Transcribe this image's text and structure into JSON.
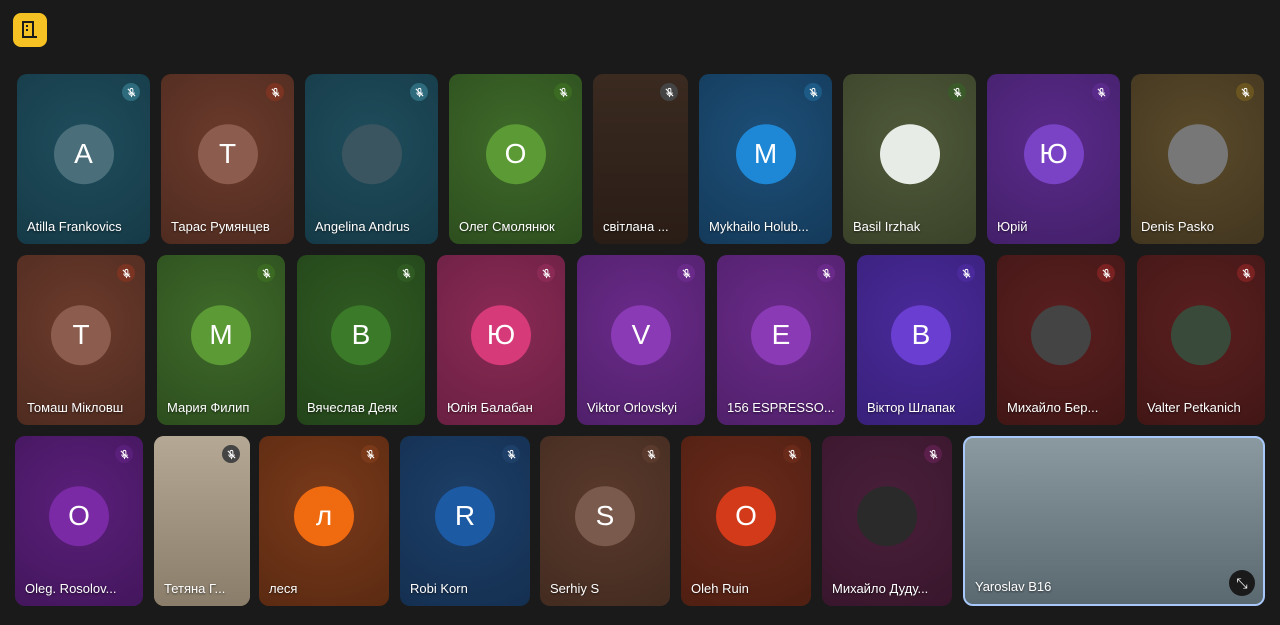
{
  "topbar": {
    "icon": "building-icon"
  },
  "participants": [
    {
      "name": "Atilla Frankovics",
      "initial": "A",
      "bg": "#1f4d5c",
      "bg2": "#163a47",
      "avatar": "#4a6f7b",
      "mic": "#2d6b7d"
    },
    {
      "name": "Тарас Румянцев",
      "initial": "T",
      "bg": "#6b3b2c",
      "bg2": "#4f2b20",
      "avatar": "#8c5d4e",
      "mic": "#7a3421"
    },
    {
      "name": "Angelina Andrus",
      "initial": "",
      "bg": "#1f4d5c",
      "bg2": "#163a47",
      "avatar": "#3b5560",
      "mic": "#2d6b7d",
      "photo": true
    },
    {
      "name": "Олег Смолянюк",
      "initial": "O",
      "bg": "#3f6a2a",
      "bg2": "#2d4e1e",
      "avatar": "#5b9a35",
      "mic": "#3b6a22"
    },
    {
      "name": "світлана ...",
      "initial": "",
      "bg": "#3a2a20",
      "bg2": "#2a1d16",
      "avatar": "transparent",
      "mic": "#444",
      "video": true
    },
    {
      "name": "Mykhailo Holub...",
      "initial": "M",
      "bg": "#1d4f78",
      "bg2": "#143a5a",
      "avatar": "#1e88d6",
      "mic": "#1d5a86"
    },
    {
      "name": "Basil Irzhak",
      "initial": "",
      "bg": "#505a3a",
      "bg2": "#3a4229",
      "avatar": "#e8ece6",
      "mic": "#3a5a2a",
      "photo": true
    },
    {
      "name": "Юрій",
      "initial": "Ю",
      "bg": "#5a2a8a",
      "bg2": "#43206a",
      "avatar": "#7a42c4",
      "mic": "#5a2a8a"
    },
    {
      "name": "Denis Pasko",
      "initial": "",
      "bg": "#5a4a2a",
      "bg2": "#423620",
      "avatar": "#777",
      "mic": "#6a5520",
      "photo": true
    },
    {
      "name": "Томаш Мікловш",
      "initial": "T",
      "bg": "#6b3b2c",
      "bg2": "#4f2b20",
      "avatar": "#8c5d4e",
      "mic": "#7a3421"
    },
    {
      "name": "Мария Филип",
      "initial": "M",
      "bg": "#3f6a2a",
      "bg2": "#2d4e1e",
      "avatar": "#5b9a35",
      "mic": "#3b6a22"
    },
    {
      "name": "Вячеслав Деяк",
      "initial": "B",
      "bg": "#2f5a22",
      "bg2": "#23441a",
      "avatar": "#3b7a28",
      "mic": "#2f5a22"
    },
    {
      "name": "Юлія Балабан",
      "initial": "Ю",
      "bg": "#8a2a55",
      "bg2": "#6a2042",
      "avatar": "#d63a78",
      "mic": "#8a2a55"
    },
    {
      "name": "Viktor Orlovskyi",
      "initial": "V",
      "bg": "#6a2a8a",
      "bg2": "#50206a",
      "avatar": "#8a3ab4",
      "mic": "#6a2a8a"
    },
    {
      "name": "156 ESPRESSO...",
      "initial": "E",
      "bg": "#6a2a8a",
      "bg2": "#50206a",
      "avatar": "#8a3ab4",
      "mic": "#6a2a8a"
    },
    {
      "name": "Віктор Шлапак",
      "initial": "B",
      "bg": "#4a2a9a",
      "bg2": "#38207a",
      "avatar": "#6a3ed0",
      "mic": "#4a2a9a"
    },
    {
      "name": "Михайло Бер...",
      "initial": "",
      "bg": "#5a1f1f",
      "bg2": "#421616",
      "avatar": "#444",
      "mic": "#7a2121",
      "photo": true
    },
    {
      "name": "Valter Petkanich",
      "initial": "",
      "bg": "#5a1f1f",
      "bg2": "#421616",
      "avatar": "#3a4a3a",
      "mic": "#7a2121",
      "photo": true
    },
    {
      "name": "Oleg. Rosolov...",
      "initial": "O",
      "bg": "#5a1f7a",
      "bg2": "#43165c",
      "avatar": "#7a2aa4",
      "mic": "#5a1f7a"
    },
    {
      "name": "Тетяна Г...",
      "initial": "",
      "bg": "#b5a894",
      "bg2": "#8a7d6a",
      "avatar": "transparent",
      "mic": "#444",
      "video": true
    },
    {
      "name": "леся",
      "initial": "л",
      "bg": "#7a3a1a",
      "bg2": "#5a2a12",
      "avatar": "#f06a10",
      "mic": "#7a3a1a"
    },
    {
      "name": "Robi Korn",
      "initial": "R",
      "bg": "#1d3f68",
      "bg2": "#142f50",
      "avatar": "#1d5aa4",
      "mic": "#1d3f68"
    },
    {
      "name": "Serhiy S",
      "initial": "S",
      "bg": "#5a3a2c",
      "bg2": "#432b20",
      "avatar": "#7a5a4c",
      "mic": "#5a3a2c"
    },
    {
      "name": "Oleh Ruin",
      "initial": "O",
      "bg": "#6a2a1a",
      "bg2": "#4f1f12",
      "avatar": "#d23a1a",
      "mic": "#6a2a1a"
    },
    {
      "name": "Михайло Дуду...",
      "initial": "",
      "bg": "#4a1f3a",
      "bg2": "#38162c",
      "avatar": "#2a2a2a",
      "mic": "#5a1f4a",
      "photo": true
    },
    {
      "name": "Yaroslav B16",
      "initial": "",
      "bg": "#8a9aa0",
      "bg2": "#5a6870",
      "avatar": "transparent",
      "mic": "",
      "video": true,
      "pinned": true
    }
  ]
}
